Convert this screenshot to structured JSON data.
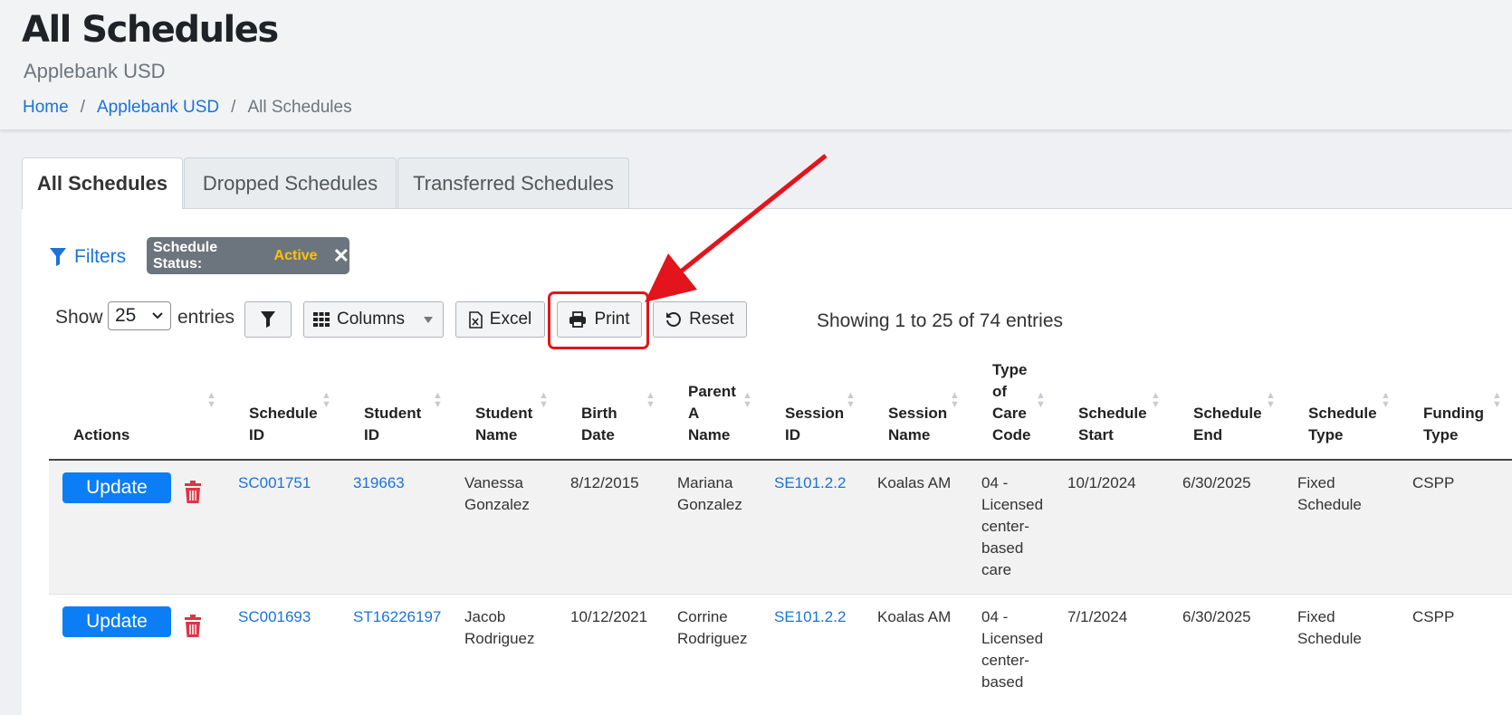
{
  "header": {
    "title": "All Schedules",
    "subtitle": "Applebank USD",
    "breadcrumb": [
      "Home",
      "Applebank USD",
      "All Schedules"
    ],
    "breadcrumb_sep": "/"
  },
  "tabs": [
    {
      "label": "All Schedules",
      "active": true
    },
    {
      "label": "Dropped Schedules",
      "active": false
    },
    {
      "label": "Transferred Schedules",
      "active": false
    }
  ],
  "filters": {
    "link_label": "Filters",
    "badge_key": "Schedule Status:",
    "badge_value": "Active",
    "badge_close": "✕"
  },
  "toolbar": {
    "show_label": "Show",
    "page_size": "25",
    "entries_label": "entries",
    "columns_label": "Columns",
    "excel_label": "Excel",
    "print_label": "Print",
    "reset_label": "Reset",
    "showing_text": "Showing 1 to 25 of 74 entries"
  },
  "table": {
    "headers": [
      [
        "Actions"
      ],
      [
        "Schedule",
        "ID"
      ],
      [
        "Student",
        "ID"
      ],
      [
        "Student",
        "Name"
      ],
      [
        "Birth",
        "Date"
      ],
      [
        "Parent",
        "A",
        "Name"
      ],
      [
        "Session",
        "ID"
      ],
      [
        "Session",
        "Name"
      ],
      [
        "Type",
        "of",
        "Care",
        "Code"
      ],
      [
        "Schedule",
        "Start"
      ],
      [
        "Schedule",
        "End"
      ],
      [
        "Schedule",
        "Type"
      ],
      [
        "Funding",
        "Type"
      ]
    ],
    "update_label": "Update",
    "rows": [
      {
        "schedule_id": "SC001751",
        "student_id": "319663",
        "student_name": [
          "Vanessa",
          "Gonzalez"
        ],
        "birth_date": "8/12/2015",
        "parent_name": [
          "Mariana",
          "Gonzalez"
        ],
        "session_id": "SE101.2.2",
        "session_name": "Koalas AM",
        "care_code": [
          "04 -",
          "Licensed",
          "center-",
          "based",
          "care"
        ],
        "start": "10/1/2024",
        "end": "6/30/2025",
        "type": [
          "Fixed",
          "Schedule"
        ],
        "funding": "CSPP"
      },
      {
        "schedule_id": "SC001693",
        "student_id": "ST16226197",
        "student_name": [
          "Jacob",
          "Rodriguez"
        ],
        "birth_date": "10/12/2021",
        "parent_name": [
          "Corrine",
          "Rodriguez"
        ],
        "session_id": "SE101.2.2",
        "session_name": "Koalas AM",
        "care_code": [
          "04 -",
          "Licensed",
          "center-",
          "based"
        ],
        "start": "7/1/2024",
        "end": "6/30/2025",
        "type": [
          "Fixed",
          "Schedule"
        ],
        "funding": "CSPP"
      }
    ]
  },
  "colors": {
    "link": "#1a73d9",
    "primary": "#0b7ef5",
    "danger": "#dc3545",
    "highlight": "#e3141b",
    "badge_value": "#ffc107"
  }
}
